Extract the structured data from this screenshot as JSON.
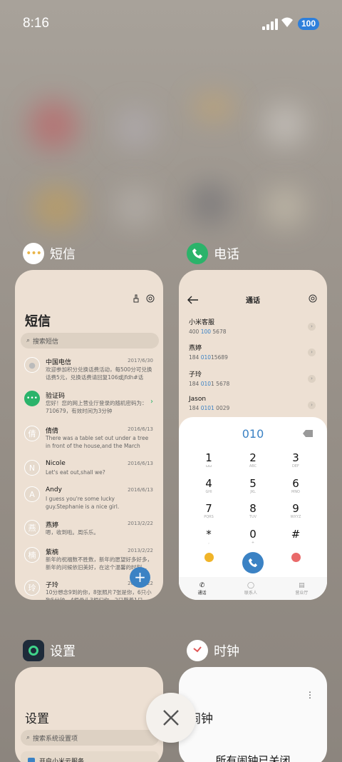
{
  "status": {
    "time": "8:16",
    "battery": "100"
  },
  "apps": [
    {
      "name": "短信"
    },
    {
      "name": "电话"
    },
    {
      "name": "设置"
    },
    {
      "name": "时钟"
    }
  ],
  "messages": {
    "title": "短信",
    "search_placeholder": "搜索短信",
    "items": [
      {
        "avatar": "",
        "name": "中国电信",
        "date": "2017/6/30",
        "text": "欢迎参加积分兑换话费活动，每500分可兑换话费5元，兑换话费请回复106或jfdh#话费..."
      },
      {
        "avatar": "",
        "name": "验证码",
        "date": "",
        "text": "您好！您的网上营业厅登录的随机密码为：710679，有效时间为3分钟"
      },
      {
        "avatar": "倩",
        "name": "倩倩",
        "date": "2016/6/13",
        "text": "There was a table set out under a tree in front of the house,and the March Hare an..."
      },
      {
        "avatar": "N",
        "name": "Nicole",
        "date": "2016/6/13",
        "text": "Let's eat out,shall we?"
      },
      {
        "avatar": "A",
        "name": "Andy",
        "date": "2016/6/13",
        "text": "I guess you're some lucky guy.Stephanie is a nice girl."
      },
      {
        "avatar": "燕",
        "name": "燕婷",
        "date": "2013/2/22",
        "text": "嗯，收到啦。周乐乐。"
      },
      {
        "avatar": "楠",
        "name": "紫楠",
        "date": "2013/2/22",
        "text": "新年的祝福数不胜数，新年的愿望好多好多，新年的问候依旧美好，在这个温馨的时刻..."
      },
      {
        "avatar": "玲",
        "name": "子玲",
        "date": "2013/2/22",
        "text": "10分想念9到的你，8张照片7张是你，6只小狗5分钟，4根骨头3根归你，2只馨着1只..."
      }
    ]
  },
  "phone": {
    "title": "通话",
    "contacts": [
      {
        "name": "小米客服",
        "num_a": "400 ",
        "num_b": "100",
        "num_c": " 5678"
      },
      {
        "name": "燕婷",
        "num_a": "184 ",
        "num_b": "010",
        "num_c": "15689"
      },
      {
        "name": "子玲",
        "num_a": "184 ",
        "num_b": "010",
        "num_c": "1 5678"
      },
      {
        "name": "Jason",
        "num_a": "184 ",
        "num_b": "0101",
        "num_c": " 0029"
      }
    ],
    "dial_value": "010",
    "keys": [
      {
        "d": "1",
        "l": "ωω"
      },
      {
        "d": "2",
        "l": "ABC"
      },
      {
        "d": "3",
        "l": "DEF"
      },
      {
        "d": "4",
        "l": "GHI"
      },
      {
        "d": "5",
        "l": "JKL"
      },
      {
        "d": "6",
        "l": "MNO"
      },
      {
        "d": "7",
        "l": "PQRS"
      },
      {
        "d": "8",
        "l": "TUV"
      },
      {
        "d": "9",
        "l": "WXYZ"
      },
      {
        "d": "*",
        "l": ","
      },
      {
        "d": "0",
        "l": "+"
      },
      {
        "d": "#",
        "l": ""
      }
    ],
    "tabs": [
      "通话",
      "联系人",
      "营业厅"
    ]
  },
  "settings": {
    "title": "设置",
    "search_placeholder": "搜索系统设置项",
    "first_item": "开启小米云服务"
  },
  "clock": {
    "title": "闹钟",
    "status": "所有闹钟已关闭"
  }
}
